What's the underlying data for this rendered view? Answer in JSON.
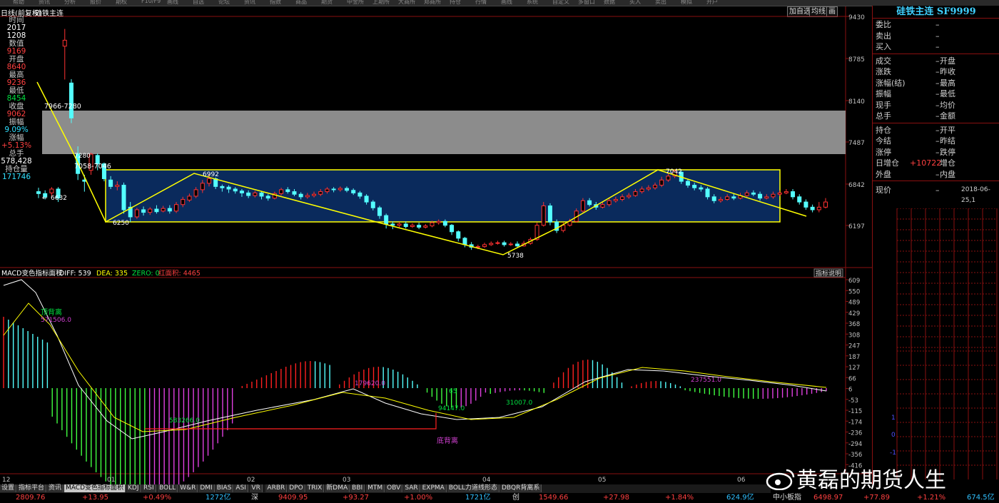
{
  "toolbar": {
    "items": [
      "帮助",
      "资讯",
      "分析",
      "报价",
      "期权",
      "F10/F9",
      "画线",
      "自选",
      "论坛",
      "资讯",
      "指数",
      "商品",
      "期货",
      "中金所",
      "上期所",
      "大商所",
      "郑商所",
      "持仓",
      "行情",
      "画线",
      "系统",
      "自定义",
      "多窗口",
      "数据",
      "买入",
      "卖出",
      "模拟",
      "开户"
    ]
  },
  "chart_header": {
    "period": "日线(前复权)",
    "name": "硅铁主连",
    "btn_add": "加自选",
    "btn_ma": "均线",
    "btn_pic": "画"
  },
  "info_panel": [
    {
      "label": "时间",
      "value": "2017",
      "value2": "1208",
      "color": "white"
    },
    {
      "label": "数值",
      "value": "9169",
      "color": "red"
    },
    {
      "label": "开盘",
      "value": "8640",
      "color": "red"
    },
    {
      "label": "最高",
      "value": "9236",
      "color": "red"
    },
    {
      "label": "最低",
      "value": "8454",
      "color": "green"
    },
    {
      "label": "收盘",
      "value": "9062",
      "color": "red"
    },
    {
      "label": "振幅",
      "value": "9.09%",
      "color": "cyan"
    },
    {
      "label": "涨幅",
      "value": "+5.13%",
      "color": "red"
    },
    {
      "label": "总手",
      "value": "578,428",
      "color": "white"
    },
    {
      "label": "持仓量",
      "value": "171746",
      "color": "cyan"
    }
  ],
  "price_axis": [
    "9430",
    "8785",
    "8140",
    "7487",
    "6842",
    "6197"
  ],
  "annotations": {
    "top_zone": "7966-7280",
    "p7280": "7280",
    "mid_zone": "7058-7046",
    "p6992": "6992",
    "p6632": "6632",
    "p6250": "6250",
    "p5738": "5738",
    "p7042": "7042"
  },
  "macd_header": {
    "name": "MACD变色指标面积",
    "diff_label": "DIFF: 539",
    "dea_label": "DEA: 335",
    "zero_label": "ZERO: 0",
    "area_label": "红面积: 4465",
    "help": "指标说明"
  },
  "macd_axis": [
    "609",
    "550",
    "489",
    "429",
    "368",
    "308",
    "247",
    "187",
    "127",
    "66",
    "6",
    "-53",
    "-115",
    "-174",
    "-236",
    "-294",
    "-356",
    "-416"
  ],
  "macd_annotations": {
    "top_div": "顶背离",
    "v1": "571506.0",
    "v2": "583266.0",
    "v3": "179620.0",
    "v4": "94147.0",
    "v5": "31007.0",
    "v6": "237551.0",
    "v7": "65",
    "bottom_div": "底背离"
  },
  "x_axis": [
    "12",
    "01",
    "02",
    "03",
    "04",
    "05",
    "06"
  ],
  "right_panel": {
    "title": "硅铁主连 SF9999",
    "rows1": [
      {
        "l": "委比",
        "v": "–",
        "r": ""
      },
      {
        "l": "卖出",
        "v": "–",
        "r": ""
      },
      {
        "l": "买入",
        "v": "–",
        "r": ""
      }
    ],
    "rows2": [
      {
        "l": "成交",
        "v": "–",
        "r": "开盘"
      },
      {
        "l": "涨跌",
        "v": "–",
        "r": "昨收"
      },
      {
        "l": "涨幅(结)",
        "v": "–",
        "r": "最高"
      },
      {
        "l": "振幅",
        "v": "–",
        "r": "最低"
      },
      {
        "l": "现手",
        "v": "–",
        "r": "均价"
      },
      {
        "l": "总手",
        "v": "–",
        "r": "金额"
      }
    ],
    "rows3": [
      {
        "l": "持仓",
        "v": "–",
        "r": "开平"
      },
      {
        "l": "今结",
        "v": "–",
        "r": "昨结"
      },
      {
        "l": "涨停",
        "v": "–",
        "r": "跌停"
      },
      {
        "l": "日增仓",
        "v": "+10722",
        "r": "增仓"
      },
      {
        "l": "外盘",
        "v": "–",
        "r": "内盘"
      }
    ],
    "tick_label": "现价",
    "tick_value": "–",
    "tick_date": "2018-06-25,1"
  },
  "mini_axis": [
    "1",
    "0",
    "-1"
  ],
  "tabs": [
    "设置",
    "指标平台",
    "资讯",
    "MACD变色指标面积",
    "KDJ",
    "RSI",
    "BOLL",
    "W&R",
    "DMI",
    "BIAS",
    "ASI",
    "VR",
    "ARBR",
    "DPO",
    "TRIX",
    "新DMA",
    "BBI",
    "MTM",
    "OBV",
    "SAR",
    "EXPMA",
    "BOLL力道线形态",
    "DBQR背离系"
  ],
  "statusbar": {
    "s1": "2809.76",
    "s2": "+13.95",
    "s3": "+0.49%",
    "s4": "1272亿",
    "s5": "深",
    "s6": "9409.95",
    "s7": "+93.27",
    "s8": "+1.00%",
    "s9": "1721亿",
    "s10": "创",
    "s11": "1549.66",
    "s12": "+27.98",
    "s13": "+1.84%",
    "s14": "624.9亿",
    "s15": "中小板指",
    "s16": "6498.97",
    "s17": "+77.89",
    "s18": "+1.21%",
    "s19": "674.5亿"
  },
  "watermark": "黄磊的期货人生",
  "chart_data": {
    "type": "candlestick",
    "series": [
      {
        "name": "硅铁主连",
        "values": "candles"
      }
    ],
    "y_range": [
      5700,
      9430
    ]
  }
}
